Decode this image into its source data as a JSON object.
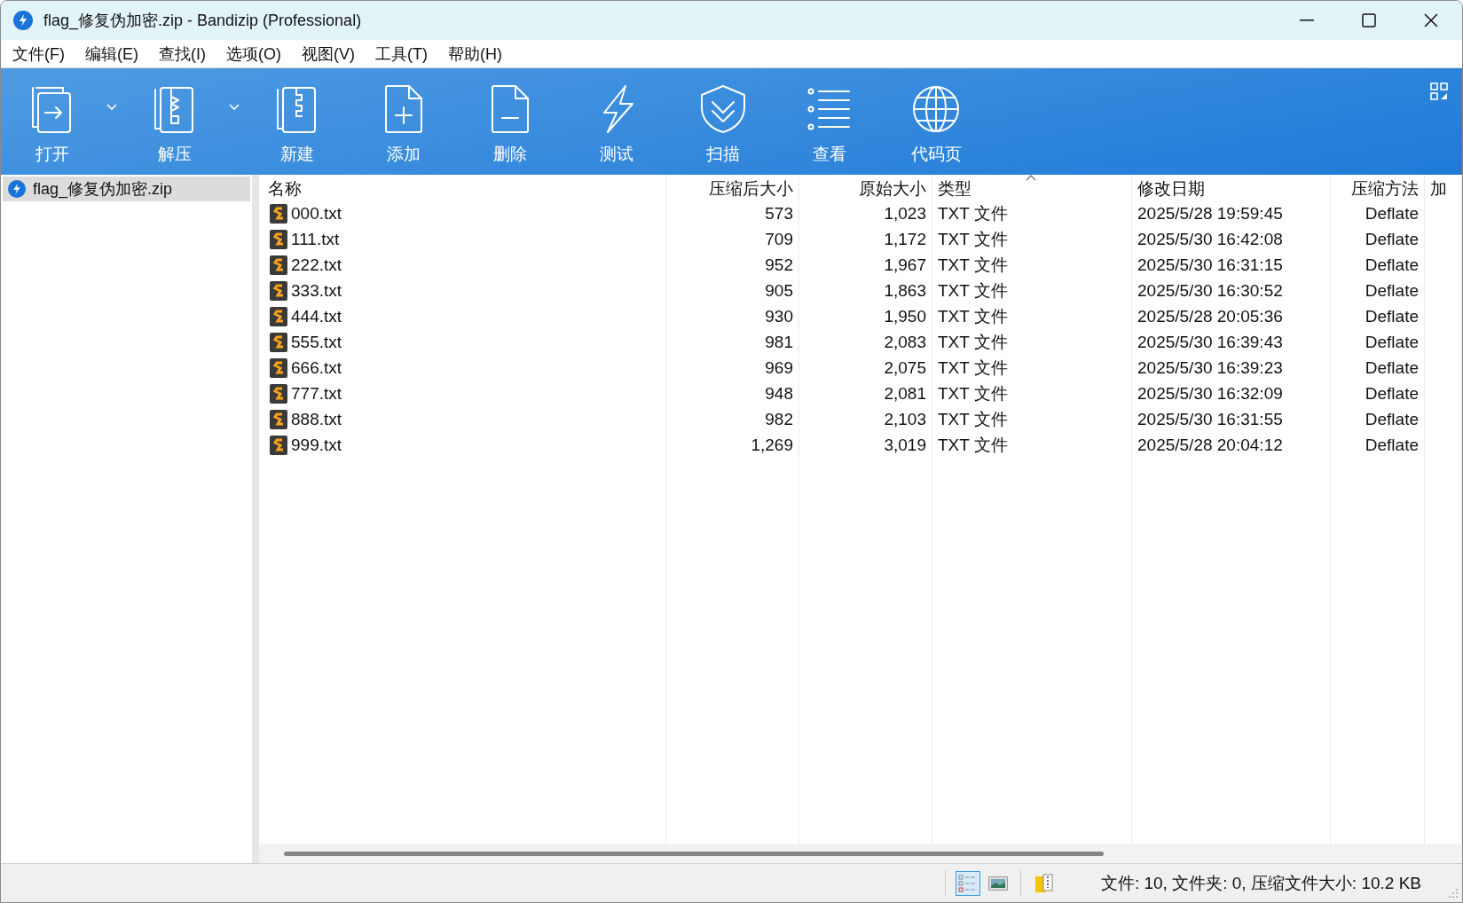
{
  "window": {
    "title": "flag_修复伪加密.zip - Bandizip (Professional)"
  },
  "menu": [
    "文件(F)",
    "编辑(E)",
    "查找(I)",
    "选项(O)",
    "视图(V)",
    "工具(T)",
    "帮助(H)"
  ],
  "toolbar": [
    {
      "label": "打开",
      "kind": "open",
      "dropdown": true
    },
    {
      "label": "解压",
      "kind": "extract",
      "dropdown": true
    },
    {
      "label": "新建",
      "kind": "new",
      "dropdown": false
    },
    {
      "label": "添加",
      "kind": "add",
      "dropdown": false
    },
    {
      "label": "删除",
      "kind": "delete",
      "dropdown": false
    },
    {
      "label": "测试",
      "kind": "test",
      "dropdown": false
    },
    {
      "label": "扫描",
      "kind": "scan",
      "dropdown": false
    },
    {
      "label": "查看",
      "kind": "view",
      "dropdown": false
    },
    {
      "label": "代码页",
      "kind": "codepage",
      "dropdown": false
    }
  ],
  "tree": [
    {
      "label": "flag_修复伪加密.zip",
      "selected": true
    }
  ],
  "table": {
    "columns": [
      {
        "label": "名称",
        "sorted": false
      },
      {
        "label": "压缩后大小",
        "sorted": false
      },
      {
        "label": "原始大小",
        "sorted": false
      },
      {
        "label": "类型",
        "sorted": true
      },
      {
        "label": "修改日期",
        "sorted": false
      },
      {
        "label": "压缩方法",
        "sorted": false
      },
      {
        "label": "加",
        "sorted": false
      }
    ],
    "rows": [
      [
        "000.txt",
        "573",
        "1,023",
        "TXT 文件",
        "2025/5/28 19:59:45",
        "Deflate"
      ],
      [
        "111.txt",
        "709",
        "1,172",
        "TXT 文件",
        "2025/5/30 16:42:08",
        "Deflate"
      ],
      [
        "222.txt",
        "952",
        "1,967",
        "TXT 文件",
        "2025/5/30 16:31:15",
        "Deflate"
      ],
      [
        "333.txt",
        "905",
        "1,863",
        "TXT 文件",
        "2025/5/30 16:30:52",
        "Deflate"
      ],
      [
        "444.txt",
        "930",
        "1,950",
        "TXT 文件",
        "2025/5/28 20:05:36",
        "Deflate"
      ],
      [
        "555.txt",
        "981",
        "2,083",
        "TXT 文件",
        "2025/5/30 16:39:43",
        "Deflate"
      ],
      [
        "666.txt",
        "969",
        "2,075",
        "TXT 文件",
        "2025/5/30 16:39:23",
        "Deflate"
      ],
      [
        "777.txt",
        "948",
        "2,081",
        "TXT 文件",
        "2025/5/30 16:32:09",
        "Deflate"
      ],
      [
        "888.txt",
        "982",
        "2,103",
        "TXT 文件",
        "2025/5/30 16:31:55",
        "Deflate"
      ],
      [
        "999.txt",
        "1,269",
        "3,019",
        "TXT 文件",
        "2025/5/28 20:04:12",
        "Deflate"
      ]
    ]
  },
  "status_bar": {
    "view_modes": [
      {
        "kind": "details",
        "selected": true
      },
      {
        "kind": "thumbnails",
        "selected": false
      }
    ],
    "text": "文件: 10, 文件夹: 0, 压缩文件大小: 10.2 KB"
  }
}
